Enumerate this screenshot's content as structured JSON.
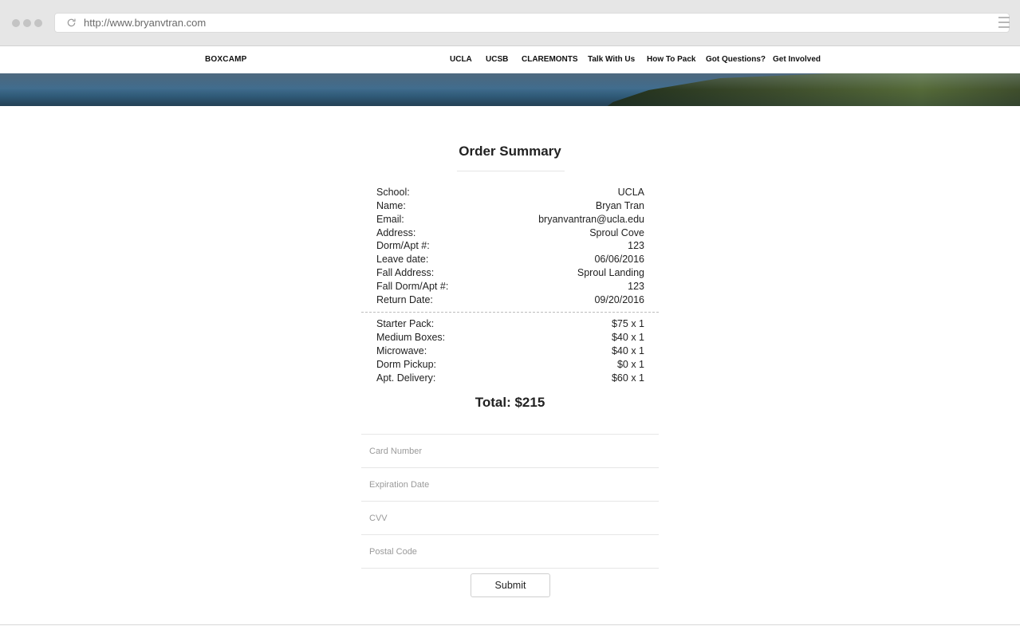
{
  "browser": {
    "url": "http://www.bryanvtran.com"
  },
  "navbar": {
    "brand": "BOXCAMP",
    "links": [
      "UCLA",
      "UCSB",
      "CLAREMONTS",
      "Talk With Us",
      "How To Pack",
      "Got Questions?",
      "Get Involved"
    ]
  },
  "summary": {
    "title": "Order Summary",
    "details": [
      {
        "label": "School:",
        "value": "UCLA"
      },
      {
        "label": "Name:",
        "value": "Bryan Tran"
      },
      {
        "label": "Email:",
        "value": "bryanvantran@ucla.edu"
      },
      {
        "label": "Address:",
        "value": "Sproul Cove"
      },
      {
        "label": "Dorm/Apt #:",
        "value": "123"
      },
      {
        "label": "Leave date:",
        "value": "06/06/2016"
      },
      {
        "label": "Fall Address:",
        "value": "Sproul Landing"
      },
      {
        "label": "Fall Dorm/Apt #:",
        "value": "123"
      },
      {
        "label": "Return Date:",
        "value": "09/20/2016"
      }
    ],
    "items": [
      {
        "label": "Starter Pack:",
        "value": "$75 x 1"
      },
      {
        "label": "Medium Boxes:",
        "value": "$40 x 1"
      },
      {
        "label": "Microwave:",
        "value": "$40 x 1"
      },
      {
        "label": "Dorm Pickup:",
        "value": "$0 x 1"
      },
      {
        "label": "Apt. Delivery:",
        "value": "$60 x 1"
      }
    ],
    "total": "Total: $215"
  },
  "payment": {
    "card_number": {
      "placeholder": "Card Number",
      "value": ""
    },
    "expiration": {
      "placeholder": "Expiration Date",
      "value": ""
    },
    "cvv": {
      "placeholder": "CVV",
      "value": ""
    },
    "postal": {
      "placeholder": "Postal Code",
      "value": ""
    },
    "submit_label": "Submit"
  },
  "colors": {
    "chrome": "#e6e6e6",
    "text": "#222222",
    "rule": "#e6e6e6"
  }
}
